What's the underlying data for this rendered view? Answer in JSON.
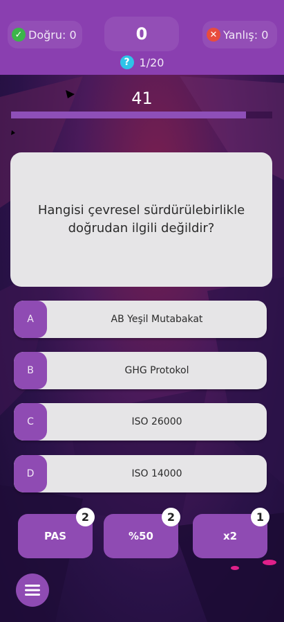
{
  "stats": {
    "correct_label": "Doğru: 0",
    "wrong_label": "Yanlış: 0",
    "score": "0",
    "question_counter": "1/20"
  },
  "timer": {
    "value": "41",
    "progress": 0.9
  },
  "question": {
    "text": "Hangisi çevresel sürdürülebirlikle doğrudan ilgili değildir?"
  },
  "options": [
    {
      "letter": "A",
      "text": "AB Yeşil Mutabakat"
    },
    {
      "letter": "B",
      "text": "GHG Protokol"
    },
    {
      "letter": "C",
      "text": "ISO 26000"
    },
    {
      "letter": "D",
      "text": "ISO 14000"
    }
  ],
  "jokers": {
    "pass": {
      "label": "PAS",
      "count": "2"
    },
    "fifty": {
      "label": "%50",
      "count": "2"
    },
    "double": {
      "label": "x2",
      "count": "1"
    }
  },
  "colors": {
    "accent": "#8f4bb3",
    "correct": "#3cb54a",
    "wrong": "#e84c3d",
    "info": "#2ec3e8"
  }
}
